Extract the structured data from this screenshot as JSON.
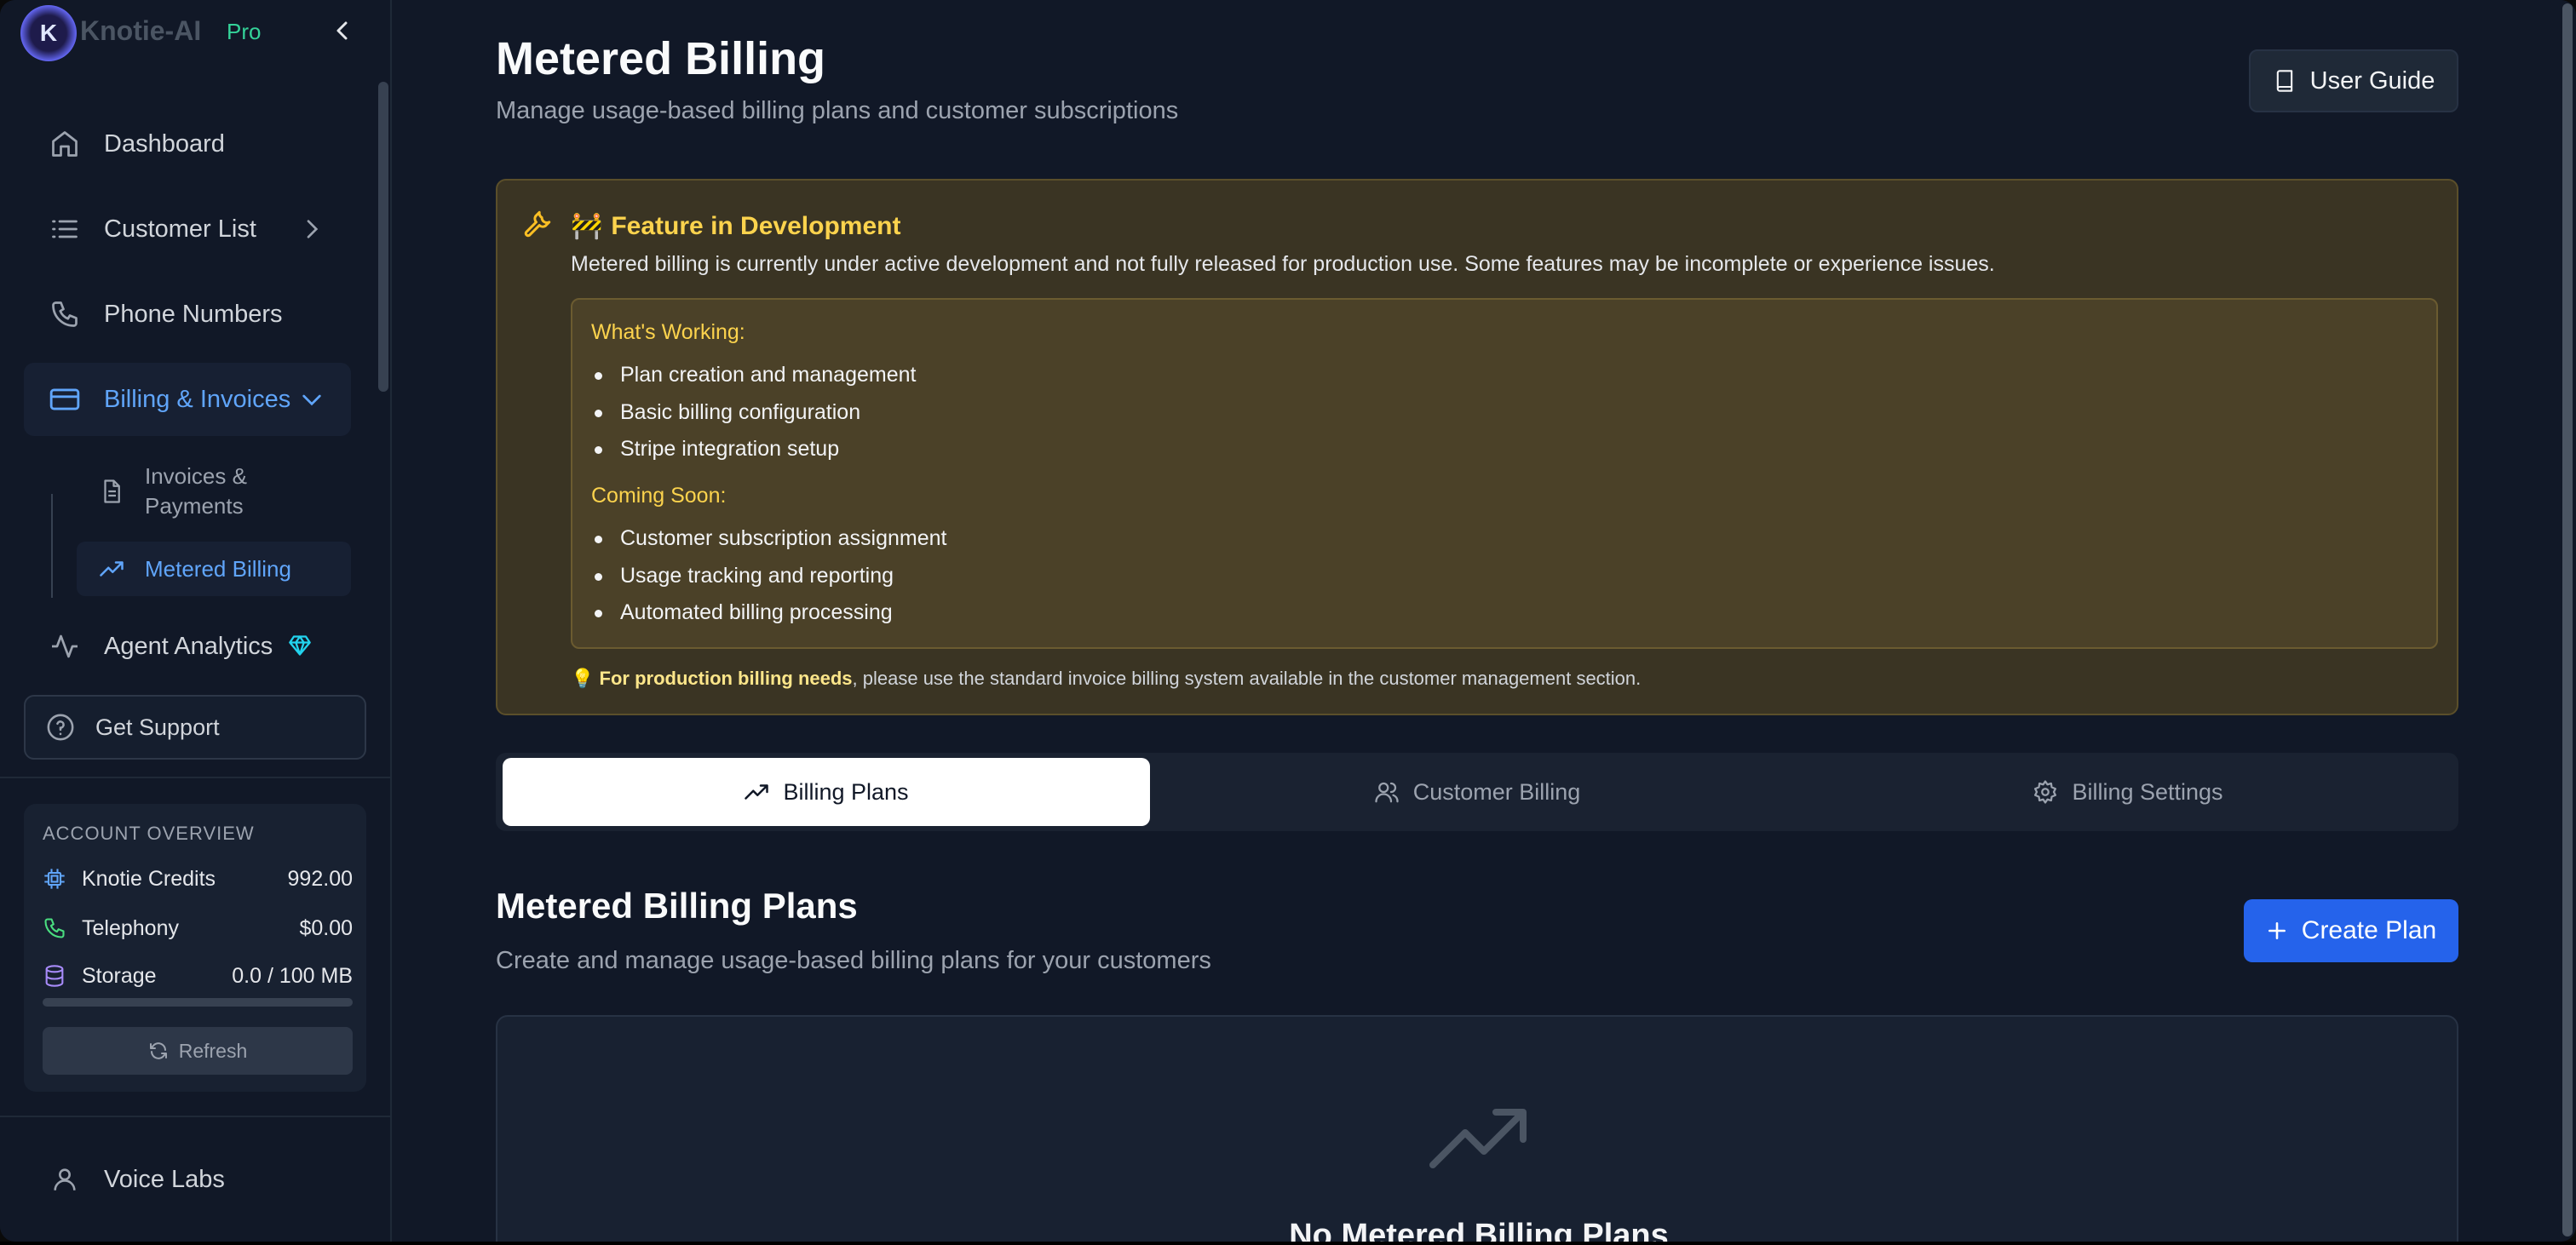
{
  "brand": {
    "logo_letter": "K",
    "name": "Knotie-AI",
    "plan": "Pro"
  },
  "sidebar": {
    "items": [
      {
        "label": "Dashboard"
      },
      {
        "label": "Customer List"
      },
      {
        "label": "Phone Numbers"
      },
      {
        "label": "Billing & Invoices"
      },
      {
        "label": "Agent Analytics"
      }
    ],
    "sub_items": [
      {
        "label": "Invoices & Payments"
      },
      {
        "label": "Metered Billing"
      }
    ],
    "support_label": "Get Support",
    "bottom_item": "Voice Labs"
  },
  "account": {
    "title": "ACCOUNT OVERVIEW",
    "rows": [
      {
        "label": "Knotie Credits",
        "value": "992.00"
      },
      {
        "label": "Telephony",
        "value": "$0.00"
      },
      {
        "label": "Storage",
        "value": "0.0 / 100 MB"
      }
    ],
    "storage_fraction": 0.0,
    "refresh_label": "Refresh"
  },
  "header": {
    "title": "Metered Billing",
    "subtitle": "Manage usage-based billing plans and customer subscriptions",
    "guide_label": "User Guide"
  },
  "notice": {
    "title_emoji": "🚧",
    "title": "Feature in Development",
    "description": "Metered billing is currently under active development and not fully released for production use. Some features may be incomplete or experience issues.",
    "working_heading": "What's Working:",
    "working_items": [
      "Plan creation and management",
      "Basic billing configuration",
      "Stripe integration setup"
    ],
    "soon_heading": "Coming Soon:",
    "soon_items": [
      "Customer subscription assignment",
      "Usage tracking and reporting",
      "Automated billing processing"
    ],
    "note_emoji": "💡",
    "note_bold": "For production billing needs",
    "note_rest": ", please use the standard invoice billing system available in the customer management section."
  },
  "tabs": [
    {
      "label": "Billing Plans",
      "icon": "trending-up-icon"
    },
    {
      "label": "Customer Billing",
      "icon": "users-icon"
    },
    {
      "label": "Billing Settings",
      "icon": "gear-icon"
    }
  ],
  "plans": {
    "title": "Metered Billing Plans",
    "subtitle": "Create and manage usage-based billing plans for your customers",
    "create_label": "Create Plan",
    "empty_title": "No Metered Billing Plans"
  },
  "colors": {
    "accent": "#2563eb",
    "active_nav": "#60a5fa",
    "warning": "#fcd34d"
  }
}
